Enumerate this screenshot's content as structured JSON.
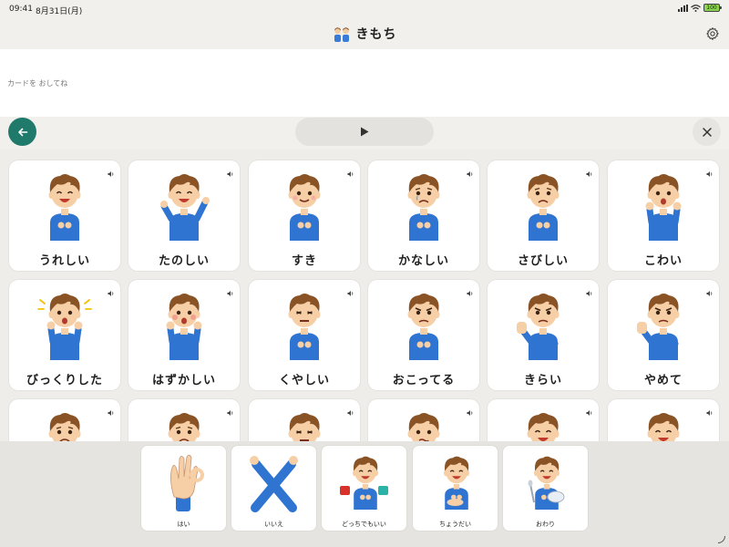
{
  "status_bar": {
    "time": "09:41",
    "date": "8月31日(月)",
    "battery": "100"
  },
  "header": {
    "title": "きもち",
    "title_icon": "children-icon",
    "settings_icon": "gear-icon"
  },
  "message": {
    "placeholder": "カードを おしてね"
  },
  "controls": {
    "back_icon": "arrow-left-icon",
    "play_icon": "play-icon",
    "clear_icon": "close-icon",
    "accent_color": "#1f7a6b"
  },
  "cards": [
    {
      "label": "うれしい",
      "mood": "happy"
    },
    {
      "label": "たのしい",
      "mood": "fun"
    },
    {
      "label": "すき",
      "mood": "love"
    },
    {
      "label": "かなしい",
      "mood": "sad"
    },
    {
      "label": "さびしい",
      "mood": "lonely"
    },
    {
      "label": "こわい",
      "mood": "scared"
    },
    {
      "label": "びっくりした",
      "mood": "surprised"
    },
    {
      "label": "はずかしい",
      "mood": "embarrassed"
    },
    {
      "label": "くやしい",
      "mood": "frustrated"
    },
    {
      "label": "おこってる",
      "mood": "angry"
    },
    {
      "label": "きらい",
      "mood": "dislike"
    },
    {
      "label": "やめて",
      "mood": "stop"
    },
    {
      "label": "",
      "mood": "tired"
    },
    {
      "label": "",
      "mood": "worried"
    },
    {
      "label": "",
      "mood": "pain"
    },
    {
      "label": "",
      "mood": "confused"
    },
    {
      "label": "",
      "mood": "calm"
    },
    {
      "label": "",
      "mood": "proud"
    }
  ],
  "quick_cards": [
    {
      "label": "はい",
      "icon": "ok-hand-icon"
    },
    {
      "label": "いいえ",
      "icon": "crossed-arms-icon"
    },
    {
      "label": "どっちでもいい",
      "icon": "choice-icon"
    },
    {
      "label": "ちょうだい",
      "icon": "give-me-icon"
    },
    {
      "label": "おわり",
      "icon": "finished-icon"
    }
  ]
}
